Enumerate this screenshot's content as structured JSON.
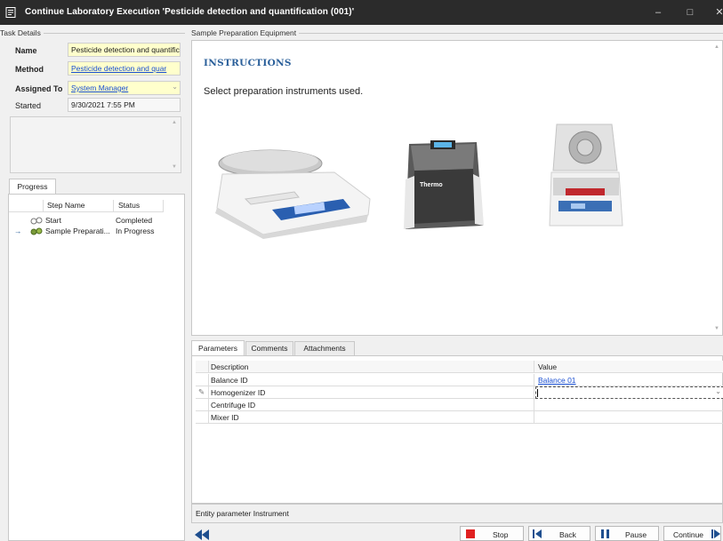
{
  "window": {
    "title": "Continue Laboratory Execution 'Pesticide detection and quantification (001)'",
    "minimize_glyph": "–",
    "maximize_glyph": "□",
    "close_glyph": "✕"
  },
  "task_details": {
    "group_label": "Task Details",
    "name_label": "Name",
    "name_value": "Pesticide detection and quantific",
    "method_label": "Method",
    "method_value": "Pesticide detection and quar",
    "assigned_label": "Assigned To",
    "assigned_value": "System Manager",
    "started_label": "Started",
    "started_value": "9/30/2021 7:55 PM"
  },
  "progress": {
    "tab_label": "Progress",
    "columns": [
      "Step Name",
      "Status"
    ],
    "rows": [
      {
        "step": "Start",
        "status": "Completed",
        "current": false
      },
      {
        "step": "Sample Preparati...",
        "status": "In Progress",
        "current": true
      }
    ],
    "current_marker": "→"
  },
  "equipment": {
    "group_label": "Sample Preparation Equipment",
    "instructions_title": "INSTRUCTIONS",
    "instructions_text": "Select preparation instruments used.",
    "homogenizer_brand": "Thermo"
  },
  "bottom_tabs": [
    "Parameters",
    "Comments",
    "Attachments"
  ],
  "parameters": {
    "columns": [
      "Description",
      "Value"
    ],
    "rows": [
      {
        "description": "Balance ID",
        "value": "Balance 01",
        "editing": false
      },
      {
        "description": "Homogenizer ID",
        "value": "",
        "editing": true
      },
      {
        "description": "Centrifuge ID",
        "value": "",
        "editing": false
      },
      {
        "description": "Mixer ID",
        "value": "",
        "editing": false
      }
    ]
  },
  "entity_bar": {
    "text": "Entity parameter Instrument"
  },
  "actions": {
    "stop": "Stop",
    "back": "Back",
    "pause": "Pause",
    "continue": "Continue"
  },
  "colors": {
    "titlebar": "#2b2b2b",
    "field_highlight": "#ffffcc",
    "link": "#1a4fd1",
    "heading": "#2a5f9a",
    "stop": "#e02020",
    "nav_blue": "#1f4f8f"
  }
}
